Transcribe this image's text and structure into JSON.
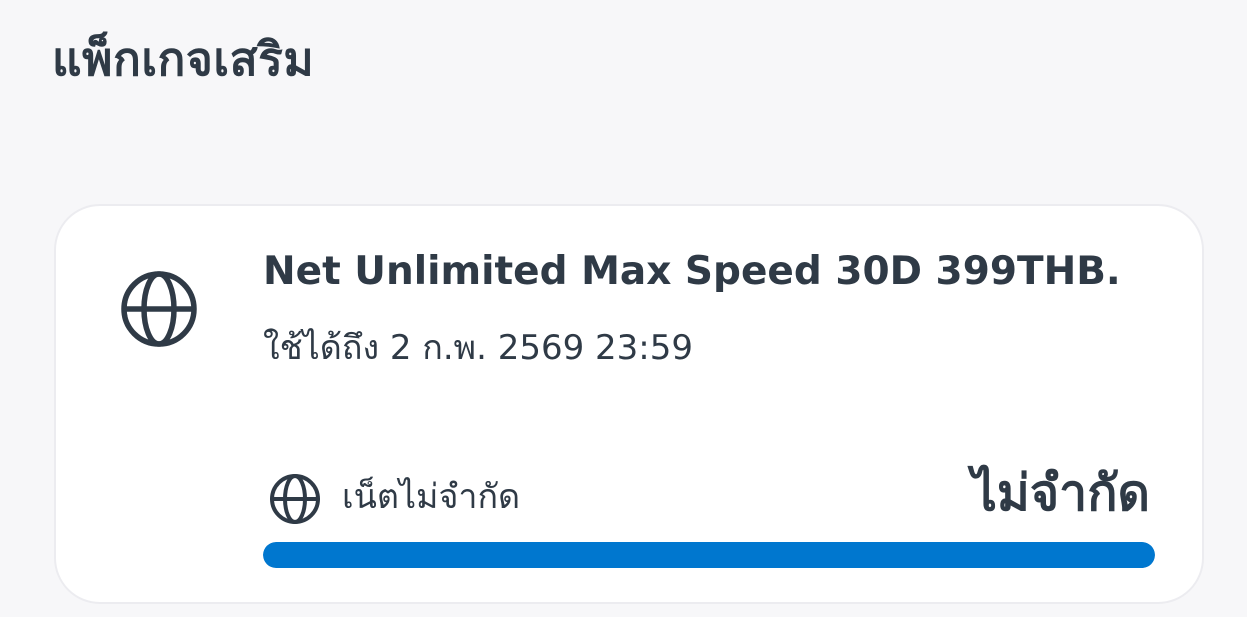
{
  "section": {
    "title": "แพ็กเกจเสริม"
  },
  "package": {
    "icon": "globe-icon",
    "name": "Net Unlimited Max Speed 30D 399THB.",
    "expiry": "ใช้ได้ถึง 2 ก.พ. 2569 23:59",
    "quota": {
      "icon": "globe-icon",
      "label": "เน็ตไม่จำกัด",
      "value": "ไม่จำกัด",
      "progress_fraction": 1.0
    }
  },
  "colors": {
    "background": "#f7f7f9",
    "card": "#ffffff",
    "text": "#2f3a46",
    "accent": "#0077cf"
  }
}
